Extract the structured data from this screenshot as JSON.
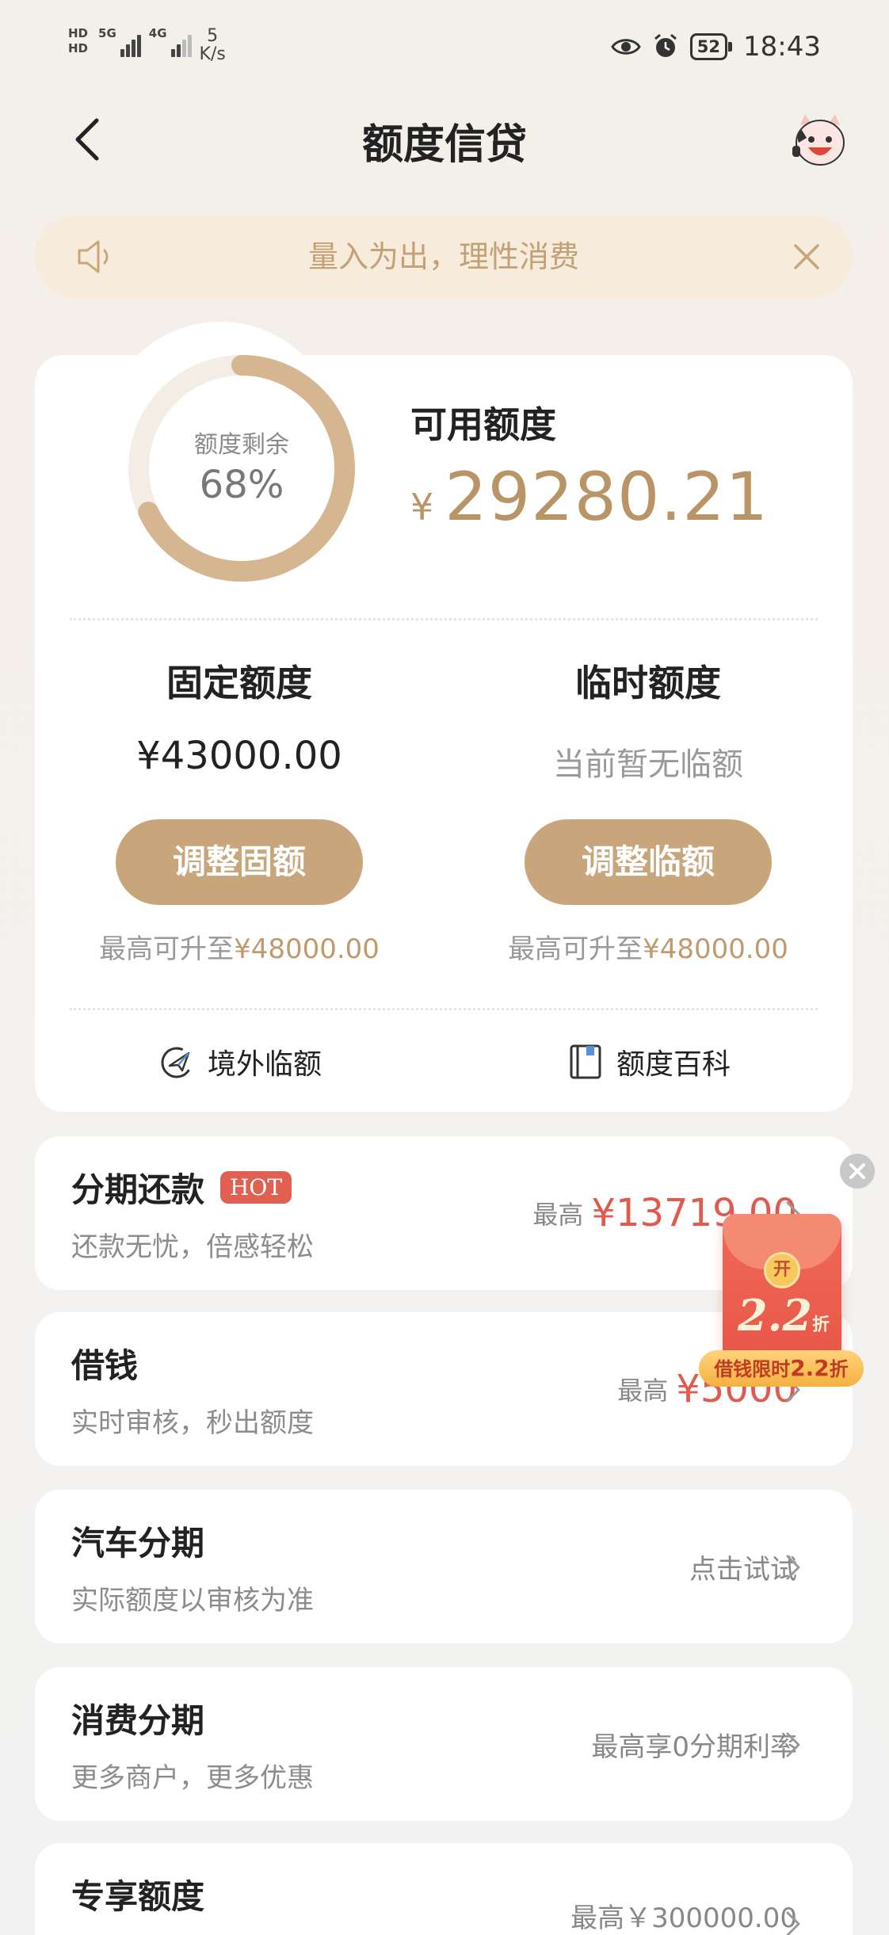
{
  "status_bar": {
    "sim1": "HD",
    "sim2": "HD",
    "net1": "5G",
    "net2": "4G",
    "speed_value": "5",
    "speed_unit": "K/s",
    "battery": "52",
    "time": "18:43",
    "icons": [
      "eye-icon",
      "alarm-icon",
      "battery-icon"
    ]
  },
  "header": {
    "title": "额度信贷",
    "back_icon": "chevron-left-icon",
    "mascot_icon": "mascot-icon"
  },
  "notice": {
    "text": "量入为出，理性消费",
    "speaker_icon": "speaker-icon",
    "close_icon": "close-icon"
  },
  "credit": {
    "remaining_label": "额度剩余",
    "remaining_percent": "68%",
    "remaining_fraction": 0.68,
    "available_label": "可用额度",
    "currency": "¥",
    "available_amount": "29280.21",
    "fixed": {
      "title": "固定额度",
      "value": "¥43000.00",
      "button": "调整固额",
      "note_prefix": "最高可升至",
      "note_amount": "¥48000.00"
    },
    "temp": {
      "title": "临时额度",
      "value": "当前暂无临额",
      "button": "调整临额",
      "note_prefix": "最高可升至",
      "note_amount": "¥48000.00"
    },
    "links": [
      {
        "label": "境外临额",
        "icon": "plane-icon"
      },
      {
        "label": "额度百科",
        "icon": "book-icon"
      }
    ]
  },
  "items": [
    {
      "title": "分期还款",
      "badge": "HOT",
      "subtitle": "还款无忧，倍感轻松",
      "prefix": "最高",
      "amount": "¥13719.00"
    },
    {
      "title": "借钱",
      "subtitle": "实时审核，秒出额度",
      "prefix": "最高",
      "amount": "¥5000"
    },
    {
      "title": "汽车分期",
      "subtitle": "实际额度以审核为准",
      "note": "点击试试"
    },
    {
      "title": "消费分期",
      "subtitle": "更多商户，更多优惠",
      "note": "最高享0分期利率"
    },
    {
      "title": "专享额度",
      "note": "最高￥300000.00"
    }
  ],
  "promo": {
    "coin": "开",
    "discount": "2.2",
    "discount_unit": "折",
    "tag_prefix": "借钱限时",
    "tag_value": "2.2",
    "tag_suffix": "折",
    "colors": {
      "envelope": "#e85646",
      "tag": "#f4b140"
    }
  },
  "colors": {
    "accent_gold": "#c9a57b",
    "amount_red": "#e05a4e",
    "notice_bg": "#f7ecdb"
  }
}
